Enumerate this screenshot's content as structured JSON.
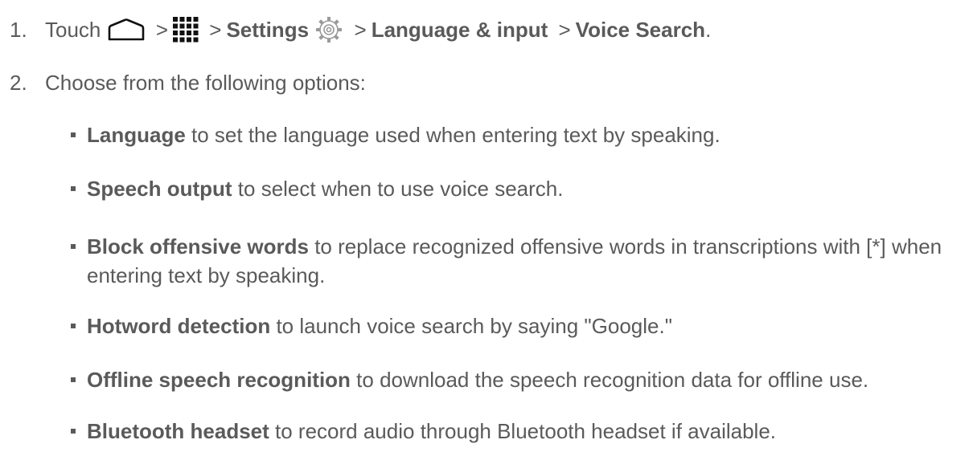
{
  "steps": [
    {
      "number": "1.",
      "parts": {
        "touch": "Touch",
        "sep1": ">",
        "sep2": ">",
        "settings": "Settings",
        "sep3": ">",
        "language_input": "Language & input",
        "sep4": ">",
        "voice_search": "Voice Search",
        "period": "."
      },
      "icons": [
        "home-icon",
        "apps-icon",
        "gear-icon"
      ]
    },
    {
      "number": "2.",
      "text": "Choose from the following options:"
    }
  ],
  "options": [
    {
      "bold": "Language",
      "text": " to set the language used when entering text by speaking."
    },
    {
      "bold": "Speech output",
      "text": " to select when to use voice search."
    },
    {
      "bold": "Block offensive words",
      "text": " to replace recognized offensive words in transcriptions with [*] when entering text by speaking."
    },
    {
      "bold": "Hotword detection",
      "text": " to launch voice search by saying \"Google.\""
    },
    {
      "bold": "Offline speech recognition",
      "text": " to download the speech recognition data for offline use."
    },
    {
      "bold": "Bluetooth headset",
      "text": " to record audio through Bluetooth headset if available."
    }
  ],
  "colors": {
    "text": "#5a5a5a",
    "background": "#ffffff"
  }
}
